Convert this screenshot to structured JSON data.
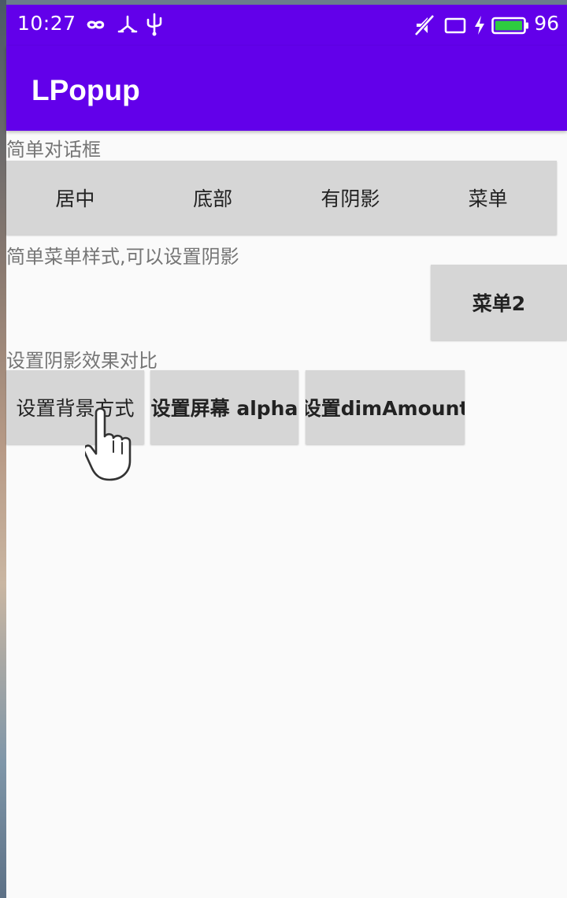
{
  "status_bar": {
    "time": "10:27",
    "battery_percent": "96",
    "icons": [
      "infinity-icon",
      "usb-debug-icon",
      "usb-icon",
      "mute-icon",
      "screen-icon",
      "charging-icon",
      "battery-icon"
    ]
  },
  "toolbar": {
    "title": "LPopup"
  },
  "sections": {
    "simple_dialog": {
      "label": "简单对话框",
      "buttons": [
        "居中",
        "底部",
        "有阴影",
        "菜单"
      ]
    },
    "simple_menu": {
      "label": "简单菜单样式,可以设置阴影",
      "button": "菜单2"
    },
    "shadow_compare": {
      "label": "设置阴影效果对比",
      "buttons": [
        "设置背景方式",
        "设置屏幕 alpha",
        "设置dimAmount"
      ]
    }
  },
  "colors": {
    "primary": "#6200ea",
    "button_bg": "#d6d6d6",
    "background": "#fafafa",
    "label_text": "#757575"
  }
}
